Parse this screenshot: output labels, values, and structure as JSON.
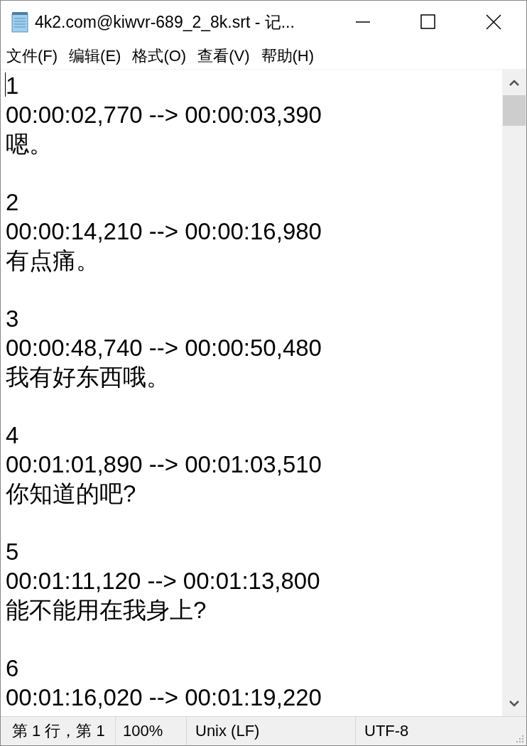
{
  "window": {
    "title": "4k2.com@kiwvr-689_2_8k.srt - 记..."
  },
  "menu": [
    {
      "label": "文件(F)"
    },
    {
      "label": "编辑(E)"
    },
    {
      "label": "格式(O)"
    },
    {
      "label": "查看(V)"
    },
    {
      "label": "帮助(H)"
    }
  ],
  "document": {
    "entries": [
      {
        "number": "1",
        "time": "00:00:02,770 --> 00:00:03,390",
        "text": "嗯。"
      },
      {
        "number": "2",
        "time": "00:00:14,210 --> 00:00:16,980",
        "text": "有点痛。"
      },
      {
        "number": "3",
        "time": "00:00:48,740 --> 00:00:50,480",
        "text": "我有好东西哦。"
      },
      {
        "number": "4",
        "time": "00:01:01,890 --> 00:01:03,510",
        "text": "你知道的吧?"
      },
      {
        "number": "5",
        "time": "00:01:11,120 --> 00:01:13,800",
        "text": "能不能用在我身上?"
      },
      {
        "number": "6",
        "time": "00:01:16,020 --> 00:01:19,220"
      }
    ]
  },
  "status_bar": [
    {
      "kind": "position",
      "text": "第 1 行，第 1"
    },
    {
      "kind": "zoom",
      "text": "100%"
    },
    {
      "kind": "line_ending",
      "text": "Unix (LF)"
    },
    {
      "kind": "encoding",
      "text": "UTF-8"
    }
  ]
}
